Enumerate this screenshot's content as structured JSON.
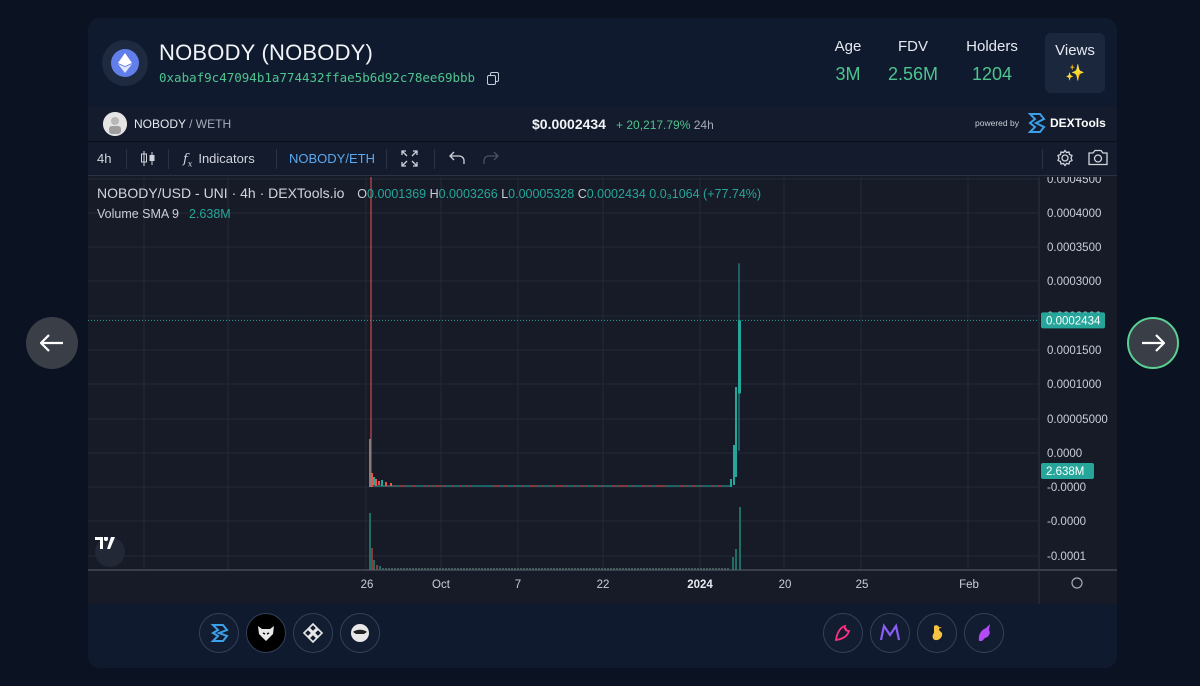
{
  "header": {
    "chain_icon": "ethereum-icon",
    "token_name": "NOBODY (NOBODY)",
    "token_address": "0xabaf9c47094b1a774432ffae5b6d92c78ee69bbb",
    "stats": [
      {
        "label": "Age",
        "value": "3M"
      },
      {
        "label": "FDV",
        "value": "2.56M"
      },
      {
        "label": "Holders",
        "value": "1204"
      }
    ],
    "views_label": "Views",
    "views_icon": "✨"
  },
  "info_bar": {
    "pair_base": "NOBODY",
    "pair_quote": "/ WETH",
    "price": "$0.0002434",
    "change": "+ 20,217.79%",
    "period": "24h",
    "powered_by": "powered by",
    "brand": "DEXTools"
  },
  "toolbar": {
    "interval": "4h",
    "indicators": "Indicators",
    "symbol": "NOBODY/ETH"
  },
  "chart_data": {
    "type": "candlestick",
    "title": "NOBODY/USD - UNI · 4h · DEXTools.io",
    "ohlc": {
      "o_label": "O",
      "o": "0.0001369",
      "h_label": "H",
      "h": "0.0003266",
      "l_label": "L",
      "l": "0.00005328",
      "c_label": "C",
      "c": "0.0002434",
      "change": "0.0₃1064 (+77.74%)"
    },
    "volume_label": "Volume SMA 9",
    "volume_value": "2.638M",
    "y_ticks": [
      "0.0004500",
      "0.0004000",
      "0.0003500",
      "0.0003000",
      "0.0002500",
      "0.0002000",
      "0.0001500",
      "0.0001000",
      "0.00005000",
      "0.0000",
      "-0.0000",
      "-0.0000",
      "-0.0001"
    ],
    "x_ticks": [
      "26",
      "Oct",
      "7",
      "22",
      "2024",
      "20",
      "25",
      "Feb"
    ],
    "last_price_label": "0.0002434",
    "volume_axis_label": "2.638M",
    "ylim": [
      -0.0001,
      0.00045
    ],
    "series": [
      {
        "x": "2023-09-25",
        "open": 2e-06,
        "high": 0.00045,
        "low": 0.0,
        "close": 5e-05
      },
      {
        "x": "2023-09-26",
        "open": 2e-05,
        "high": 3e-05,
        "low": 5e-06,
        "close": 1e-05
      },
      {
        "x": "2023-10-15",
        "open": 3e-06,
        "high": 4e-06,
        "low": 2e-06,
        "close": 3e-06
      },
      {
        "x": "2024-01-05",
        "open": 3e-06,
        "high": 4e-06,
        "low": 2e-06,
        "close": 3e-06
      },
      {
        "x": "2024-01-10",
        "open": 5e-05,
        "high": 0.00012,
        "low": 4e-05,
        "close": 0.00011
      },
      {
        "x": "2024-01-11",
        "open": 0.0001369,
        "high": 0.0003266,
        "low": 5.328e-05,
        "close": 0.0002434
      }
    ],
    "colors": {
      "up": "#26a69a",
      "down": "#ef5350"
    }
  },
  "dex_left": [
    "dextools-icon",
    "wolf-icon",
    "binance-icon",
    "kucoin-icon"
  ],
  "dex_right": [
    "uniswap-icon",
    "meta-icon",
    "chicken-icon",
    "unicorn-icon"
  ],
  "nav": {
    "prev": "arrow-left-icon",
    "next": "arrow-right-icon"
  },
  "colors": {
    "accent": "#4fc48e",
    "background": "#0b1221",
    "card": "#0f1a2e"
  }
}
